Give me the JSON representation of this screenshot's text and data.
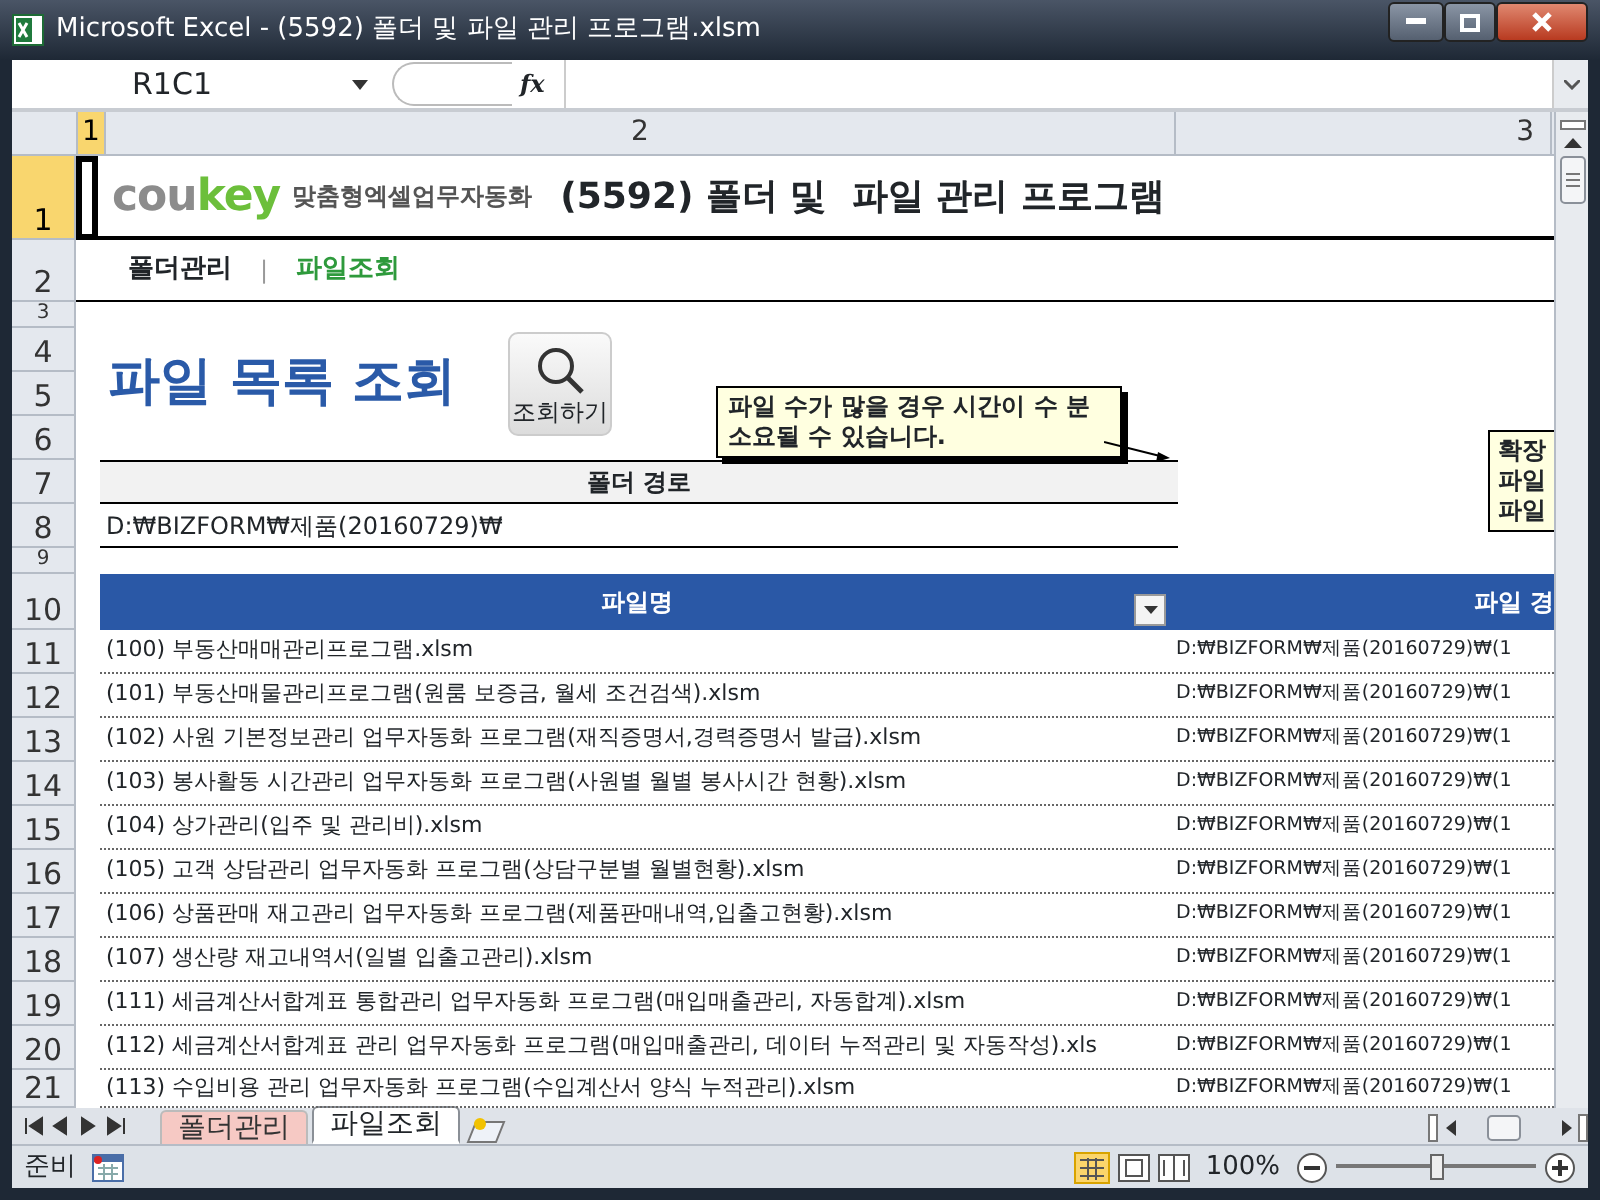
{
  "window": {
    "title": "Microsoft Excel - (5592) 폴더 및  파일 관리 프로그램.xlsm"
  },
  "formula_bar": {
    "name_box": "R1C1",
    "fx": "fx"
  },
  "column_headers": [
    {
      "label": "1",
      "selected": true
    },
    {
      "label": "2",
      "selected": false
    },
    {
      "label": "3",
      "selected": false
    }
  ],
  "row_headers": [
    {
      "label": "1",
      "selected": true
    },
    {
      "label": "2",
      "selected": false
    },
    {
      "label": "3",
      "selected": false
    },
    {
      "label": "4",
      "selected": false
    },
    {
      "label": "5",
      "selected": false
    },
    {
      "label": "6",
      "selected": false
    },
    {
      "label": "7",
      "selected": false
    },
    {
      "label": "8",
      "selected": false
    },
    {
      "label": "9",
      "selected": false
    },
    {
      "label": "10",
      "selected": false
    }
  ],
  "sheet": {
    "logo": [
      "cou",
      "key"
    ],
    "tagline": "맞춤형엑셀업무자동화",
    "heading": "(5592) 폴더 및  파일 관리 프로그램",
    "nav": [
      {
        "label": "폴더관리",
        "selected": false
      },
      {
        "label": "파일조회",
        "selected": true
      }
    ],
    "nav_separator": "|",
    "page_title": "파일 목록 조회",
    "search_button": "조회하기",
    "note": "파일 수가 많을 경우 시간이 수 분 소요될 수 있습니다.",
    "note_2": [
      "확장",
      "파일",
      "파일"
    ],
    "folder_path": {
      "header": "폴더 경로",
      "value": "D:₩BIZFORM₩제품(20160729)₩"
    }
  },
  "table": {
    "columns": [
      "파일명",
      "파일 경"
    ],
    "rows": [
      {
        "row": "11",
        "file": "(100) 부동산매매관리프로그램.xlsm",
        "path": "D:₩BIZFORM₩제품(20160729)₩(1"
      },
      {
        "row": "12",
        "file": "(101) 부동산매물관리프로그램(원룸 보증금, 월세 조건검색).xlsm",
        "path": "D:₩BIZFORM₩제품(20160729)₩(1"
      },
      {
        "row": "13",
        "file": "(102) 사원 기본정보관리 업무자동화 프로그램(재직증명서,경력증명서 발급).xlsm",
        "path": "D:₩BIZFORM₩제품(20160729)₩(1"
      },
      {
        "row": "14",
        "file": "(103) 봉사활동 시간관리 업무자동화 프로그램(사원별 월별 봉사시간 현황).xlsm",
        "path": "D:₩BIZFORM₩제품(20160729)₩(1"
      },
      {
        "row": "15",
        "file": "(104) 상가관리(입주 및 관리비).xlsm",
        "path": "D:₩BIZFORM₩제품(20160729)₩(1"
      },
      {
        "row": "16",
        "file": "(105) 고객 상담관리 업무자동화 프로그램(상담구분별 월별현황).xlsm",
        "path": "D:₩BIZFORM₩제품(20160729)₩(1"
      },
      {
        "row": "17",
        "file": "(106) 상품판매 재고관리 업무자동화 프로그램(제품판매내역,입출고현황).xlsm",
        "path": "D:₩BIZFORM₩제품(20160729)₩(1"
      },
      {
        "row": "18",
        "file": "(107) 생산량 재고내역서(일별 입출고관리).xlsm",
        "path": "D:₩BIZFORM₩제품(20160729)₩(1"
      },
      {
        "row": "19",
        "file": "(111) 세금계산서합계표 통합관리 업무자동화 프로그램(매입매출관리, 자동합계).xlsm",
        "path": "D:₩BIZFORM₩제품(20160729)₩(1"
      },
      {
        "row": "20",
        "file": "(112) 세금계산서합계표 관리 업무자동화 프로그램(매입매출관리, 데이터 누적관리 및 자동작성).xls",
        "path": "D:₩BIZFORM₩제품(20160729)₩(1"
      },
      {
        "row": "21",
        "file": "(113) 수입비용 관리 업무자동화 프로그램(수입계산서 양식 누적관리).xlsm",
        "path": "D:₩BIZFORM₩제품(20160729)₩(1"
      }
    ]
  },
  "sheet_tabs": [
    {
      "label": "폴더관리",
      "selected": false,
      "color": "#f6c9c4"
    },
    {
      "label": "파일조회",
      "selected": true,
      "color": "#ffffff"
    }
  ],
  "status_bar": {
    "text": "준비",
    "zoom": "100%",
    "zoom_slider": {
      "level": 0.5
    }
  }
}
